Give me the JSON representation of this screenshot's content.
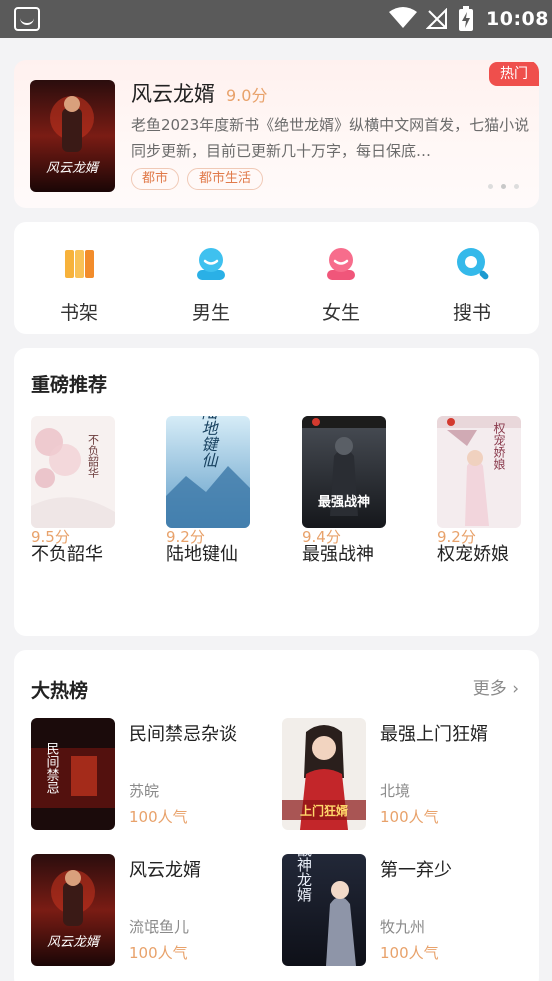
{
  "status_bar": {
    "time": "10:08"
  },
  "banner": {
    "badge": "热门",
    "title": "风云龙婿",
    "score": "9.0分",
    "description": "老鱼2023年度新书《绝世龙婿》纵横中文网首发，七猫小说同步更新，目前已更新几十万字，每日保底…",
    "tags": [
      "都市",
      "都市生活"
    ]
  },
  "nav": [
    {
      "label": "书架",
      "icon": "bookshelf-icon"
    },
    {
      "label": "男生",
      "icon": "male-icon"
    },
    {
      "label": "女生",
      "icon": "female-icon"
    },
    {
      "label": "搜书",
      "icon": "search-icon"
    }
  ],
  "recommend": {
    "title": "重磅推荐",
    "books": [
      {
        "name": "不负韶华",
        "score": "9.5分"
      },
      {
        "name": "陆地键仙",
        "score": "9.2分"
      },
      {
        "name": "最强战神",
        "score": "9.4分"
      },
      {
        "name": "权宠娇娘",
        "score": "9.2分"
      }
    ]
  },
  "hot": {
    "title": "大热榜",
    "more": "更多",
    "books": [
      {
        "name": "民间禁忌杂谈",
        "author": "苏皖",
        "popularity": "100人气"
      },
      {
        "name": "最强上门狂婿",
        "author": "北境",
        "popularity": "100人气"
      },
      {
        "name": "风云龙婿",
        "author": "流氓鱼儿",
        "popularity": "100人气"
      },
      {
        "name": "第一弃少",
        "author": "牧九州",
        "popularity": "100人气"
      }
    ]
  },
  "colors": {
    "accent": "#e8a26b",
    "hot_badge": "#ef4f4c"
  },
  "cover_art": {
    "banner": "风云龙婿",
    "recommend": [
      "不负韶华",
      "陆地键仙",
      "最强战神",
      "权宠娇娘"
    ],
    "hot": [
      "民间禁忌",
      "上门狂婿",
      "风云龙婿",
      "战神龙婿"
    ]
  }
}
